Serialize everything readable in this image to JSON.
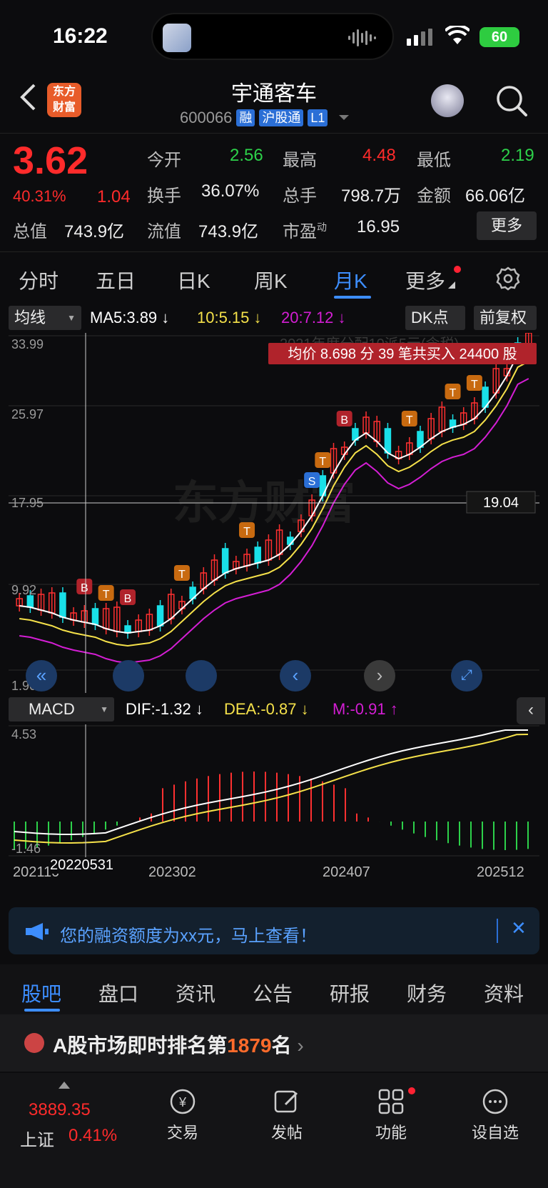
{
  "status_bar": {
    "time": "16:22",
    "battery": "60"
  },
  "header": {
    "logo_text_1": "东方",
    "logo_text_2": "财富",
    "stock_name": "宇通客车",
    "stock_code": "600066",
    "tags": [
      "融",
      "沪股通",
      "L1"
    ]
  },
  "quote": {
    "price": "3.62",
    "change_pct": "40.31%",
    "change_abs": "1.04",
    "rows": [
      [
        {
          "label": "今开",
          "value": "2.56",
          "color": "green"
        },
        {
          "label": "最高",
          "value": "4.48",
          "color": "red"
        },
        {
          "label": "最低",
          "value": "2.19",
          "color": "green"
        }
      ],
      [
        {
          "label": "换手",
          "value": "36.07%",
          "color": "white"
        },
        {
          "label": "总手",
          "value": "798.7万",
          "color": "white"
        },
        {
          "label": "金额",
          "value": "66.06亿",
          "color": "white"
        }
      ],
      [
        {
          "label": "总值",
          "value": "743.9亿",
          "color": "white"
        },
        {
          "label": "流值",
          "value": "743.9亿",
          "color": "white"
        },
        {
          "label": "市盈",
          "sup": "动",
          "value": "16.95",
          "color": "white"
        }
      ]
    ],
    "more_label": "更多"
  },
  "tabs": [
    "分时",
    "五日",
    "日K",
    "周K",
    "月K",
    "更多"
  ],
  "active_tab": "月K",
  "indicator_bar": {
    "dropdown": "均线",
    "ma5": "MA5:3.89",
    "ma10": "10:5.15",
    "ma20": "20:7.12",
    "dk_label": "DK点",
    "fuquan": "前复权"
  },
  "main_chart": {
    "y_ticks": [
      "33.99",
      "25.97",
      "17.95",
      "9.92",
      "1.90"
    ],
    "crosshair_value": "19.04",
    "tooltip": "均价 8.698 分 39 笔共买入 24400 股",
    "tooltip_behind": "2021年度分配10派5元(含税)",
    "watermark": "东方财富",
    "colors": {
      "up": "#ff3030",
      "down": "#19e0e8",
      "ma5": "#ffffff",
      "ma10": "#f5e14a",
      "ma20": "#d41ed4"
    }
  },
  "macd_bar": {
    "dropdown": "MACD",
    "dif": "DIF:-1.32",
    "dea": "DEA:-0.87",
    "m": "M:-0.91"
  },
  "macd_chart": {
    "y_ticks": [
      "4.53",
      "-1.46"
    ]
  },
  "dates": {
    "left": "202110",
    "crosshair": "20220531",
    "d1": "202302",
    "d2": "202407",
    "right": "202512"
  },
  "banner": {
    "text": "您的融资额度为xx元，马上查看！"
  },
  "bottom_tabs": [
    "股吧",
    "盘口",
    "资讯",
    "公告",
    "研报",
    "财务",
    "资料"
  ],
  "rank": {
    "prefix": "A股市场即时排名第",
    "number": "1879",
    "suffix": "名"
  },
  "footer": {
    "index_value": "3889.35",
    "index_name": "上证",
    "index_pct": "0.41%",
    "items": [
      "交易",
      "发帖",
      "功能",
      "设自选"
    ]
  }
}
